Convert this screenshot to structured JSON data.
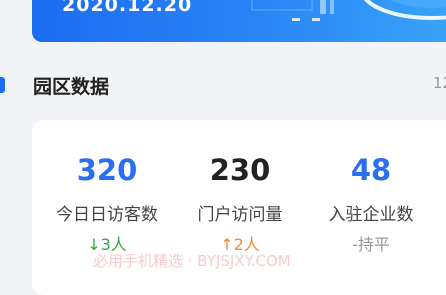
{
  "banner": {
    "date": "2020.12.20"
  },
  "section": {
    "title": "园区数据",
    "extra": "12"
  },
  "stats": [
    {
      "value": "320",
      "label": "今日日访客数",
      "arrow": "↓",
      "change": "3人"
    },
    {
      "value": "230",
      "label": "门户访问量",
      "arrow": "↑",
      "change": "2人"
    },
    {
      "value": "48",
      "label": "入驻企业数",
      "arrow": "-",
      "change": "持平"
    }
  ],
  "watermark": "必用手机精选 · BYJSJXY.COM",
  "colors": {
    "accent": "#1b6ff2",
    "value_blue": "#2a6ff0",
    "down": "#3aa542",
    "up": "#f08a3a",
    "flat": "#999999"
  }
}
